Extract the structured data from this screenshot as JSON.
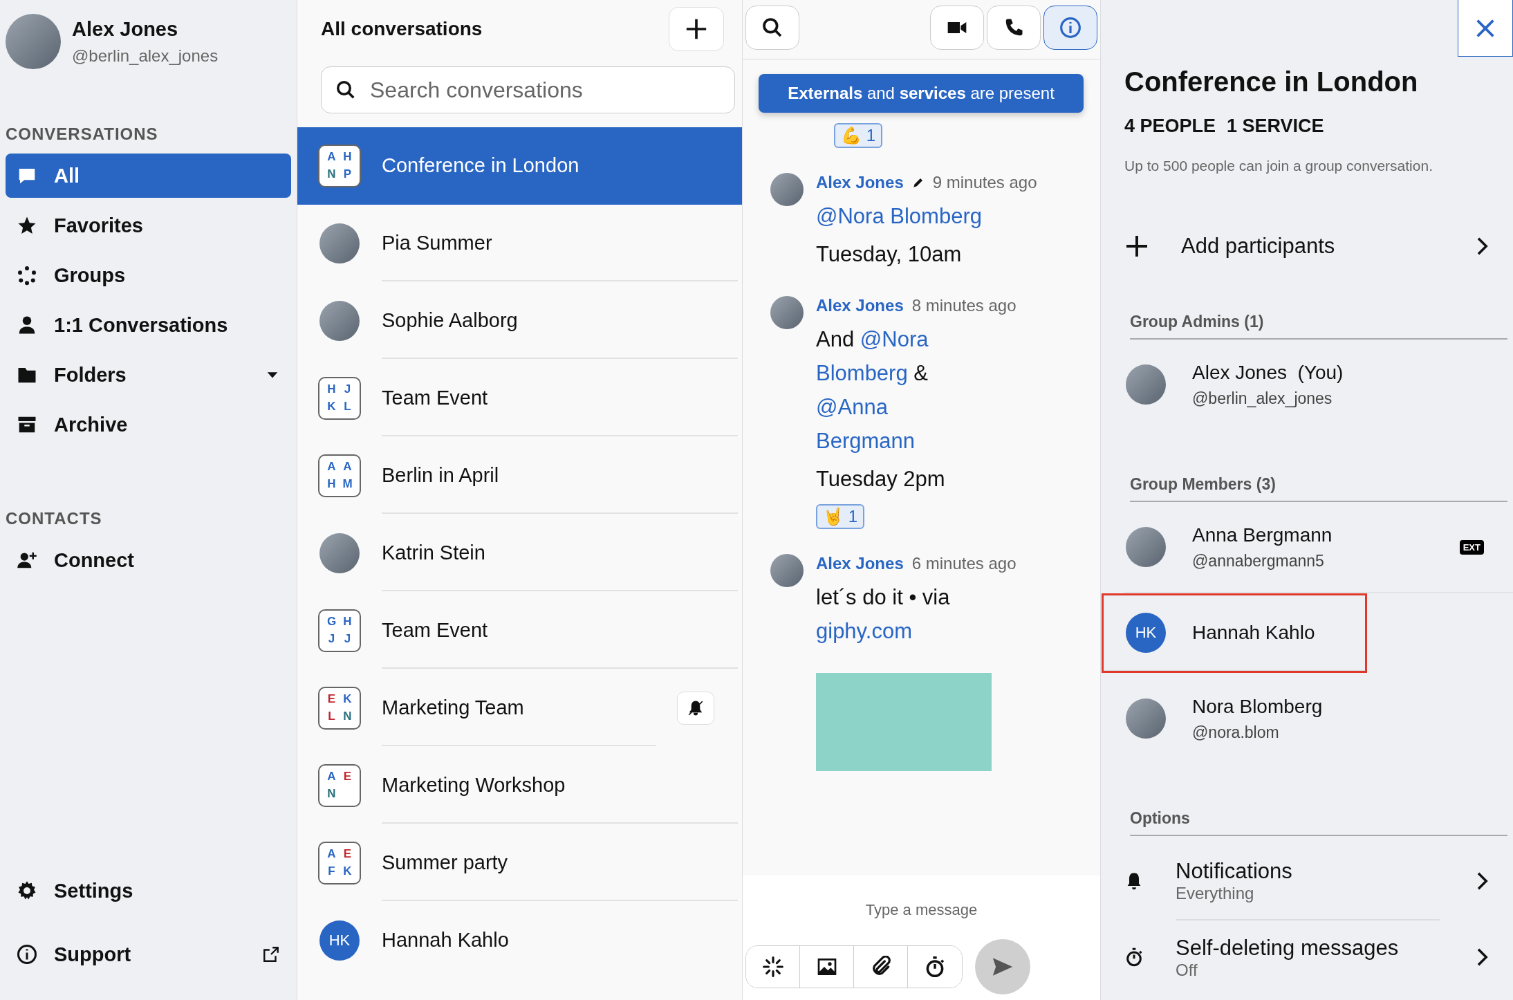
{
  "profile": {
    "name": "Alex Jones",
    "handle": "@berlin_alex_jones"
  },
  "sidebar": {
    "sections": [
      {
        "heading": "CONVERSATIONS",
        "items": [
          {
            "label": "All",
            "kind": "chat",
            "selected": true,
            "dropdown": false
          },
          {
            "label": "Favorites",
            "kind": "star",
            "selected": false,
            "dropdown": false
          },
          {
            "label": "Groups",
            "kind": "groups",
            "selected": false,
            "dropdown": false
          },
          {
            "label": "1:1 Conversations",
            "kind": "person",
            "selected": false,
            "dropdown": false
          },
          {
            "label": "Folders",
            "kind": "folder",
            "selected": false,
            "dropdown": true
          },
          {
            "label": "Archive",
            "kind": "archive",
            "selected": false,
            "dropdown": false
          }
        ]
      },
      {
        "heading": "CONTACTS",
        "items": [
          {
            "label": "Connect",
            "kind": "connect",
            "selected": false,
            "dropdown": false
          }
        ]
      }
    ],
    "footer": [
      {
        "label": "Settings",
        "kind": "gear",
        "external": false
      },
      {
        "label": "Support",
        "kind": "info",
        "external": true
      }
    ]
  },
  "conversation_list": {
    "title": "All conversations",
    "search": {
      "placeholder": "Search conversations"
    },
    "items": [
      {
        "name": "Conference in London",
        "kind": "group",
        "selected": true,
        "muted": false,
        "initials": [
          {
            "letter": "A",
            "color": "#2966c4"
          },
          {
            "letter": "H",
            "color": "#2966c4"
          },
          {
            "letter": "N",
            "color": "#2a6f7f"
          },
          {
            "letter": "P",
            "color": "#2966c4"
          }
        ]
      },
      {
        "name": "Pia Summer",
        "kind": "photo",
        "selected": false,
        "muted": false
      },
      {
        "name": "Sophie Aalborg",
        "kind": "photo",
        "selected": false,
        "muted": false
      },
      {
        "name": "Team Event",
        "kind": "group",
        "selected": false,
        "muted": false,
        "initials": [
          {
            "letter": "H",
            "color": "#2966c4"
          },
          {
            "letter": "J",
            "color": "#2966c4"
          },
          {
            "letter": "K",
            "color": "#2966c4"
          },
          {
            "letter": "L",
            "color": "#2966c4"
          }
        ]
      },
      {
        "name": "Berlin in April",
        "kind": "group",
        "selected": false,
        "muted": false,
        "initials": [
          {
            "letter": "A",
            "color": "#2966c4"
          },
          {
            "letter": "A",
            "color": "#2966c4"
          },
          {
            "letter": "H",
            "color": "#2966c4"
          },
          {
            "letter": "M",
            "color": "#2966c4"
          }
        ]
      },
      {
        "name": "Katrin Stein",
        "kind": "photo",
        "selected": false,
        "muted": false
      },
      {
        "name": "Team Event",
        "kind": "group",
        "selected": false,
        "muted": false,
        "initials": [
          {
            "letter": "G",
            "color": "#2966c4"
          },
          {
            "letter": "H",
            "color": "#2966c4"
          },
          {
            "letter": "J",
            "color": "#2966c4"
          },
          {
            "letter": "J",
            "color": "#2966c4"
          }
        ]
      },
      {
        "name": "Marketing Team",
        "kind": "group",
        "selected": false,
        "muted": true,
        "initials": [
          {
            "letter": "E",
            "color": "#c2262e"
          },
          {
            "letter": "K",
            "color": "#2966c4"
          },
          {
            "letter": "L",
            "color": "#c2262e"
          },
          {
            "letter": "N",
            "color": "#2a6f7f"
          }
        ]
      },
      {
        "name": "Marketing Workshop",
        "kind": "group",
        "selected": false,
        "muted": false,
        "initials": [
          {
            "letter": "A",
            "color": "#2966c4"
          },
          {
            "letter": "E",
            "color": "#c2262e"
          },
          {
            "letter": "N",
            "color": "#2a6f7f"
          }
        ]
      },
      {
        "name": "Summer party",
        "kind": "group",
        "selected": false,
        "muted": false,
        "initials": [
          {
            "letter": "A",
            "color": "#2966c4"
          },
          {
            "letter": "E",
            "color": "#c2262e"
          },
          {
            "letter": "F",
            "color": "#2966c4"
          },
          {
            "letter": "K",
            "color": "#2966c4"
          }
        ]
      },
      {
        "name": "Hannah Kahlo",
        "kind": "initials",
        "selected": false,
        "muted": false,
        "avatar_text": "HK"
      }
    ]
  },
  "chat": {
    "toolbar": {
      "info_open": true
    },
    "banner": "**Externals** and **services** are present",
    "messages": [
      {
        "kind": "partial",
        "reactions": [
          {
            "emoji": "💪",
            "count": "1"
          }
        ]
      },
      {
        "kind": "full",
        "author": "Alex Jones",
        "edited": true,
        "time": "9 minutes ago",
        "lines": [
          [
            {
              "kind": "mention",
              "text": "@Nora Blomberg"
            }
          ],
          [
            {
              "kind": "text",
              "text": "Tuesday, 10am"
            }
          ]
        ]
      },
      {
        "kind": "full",
        "author": "Alex Jones",
        "edited": false,
        "time": "8 minutes ago",
        "lines": [
          [
            {
              "kind": "text",
              "text": "And "
            },
            {
              "kind": "mention",
              "text": "@Nora Blomberg"
            },
            {
              "kind": "text",
              "text": " & "
            },
            {
              "kind": "mention",
              "text": "@Anna Bergmann"
            }
          ],
          [
            {
              "kind": "text",
              "text": "Tuesday 2pm"
            }
          ]
        ],
        "reactions": [
          {
            "emoji": "🤘",
            "count": "1"
          }
        ]
      },
      {
        "kind": "full",
        "author": "Alex Jones",
        "edited": false,
        "time": "6 minutes ago",
        "lines": [
          [
            {
              "kind": "text",
              "text": "let´s do it • via "
            },
            {
              "kind": "link",
              "text": "giphy.com"
            }
          ]
        ],
        "gif": true
      }
    ],
    "composer": {
      "placeholder": "Type a message",
      "tools": [
        {
          "kind": "sparkle"
        },
        {
          "kind": "image"
        },
        {
          "kind": "clip"
        },
        {
          "kind": "timer"
        }
      ],
      "send_enabled": false
    }
  },
  "details": {
    "title": "Conference in London",
    "counts": [
      "4 PEOPLE",
      "1 SERVICE"
    ],
    "note": "Up to 500 people can join a group conversation.",
    "add_label": "Add participants",
    "groups": [
      {
        "heading": "Group Admins (1)",
        "members": [
          {
            "name": "Alex Jones",
            "suffix": "(You)",
            "handle": "@berlin_alex_jones",
            "kind": "photo",
            "external": false,
            "highlighted": false
          }
        ]
      },
      {
        "heading": "Group Members (3)",
        "members": [
          {
            "name": "Anna Bergmann",
            "handle": "@annabergmann5",
            "kind": "photo",
            "external": true,
            "badge": "EXT",
            "highlighted": false
          },
          {
            "name": "Hannah Kahlo",
            "kind": "initials",
            "avatar_text": "HK",
            "external": false,
            "highlighted": true
          },
          {
            "name": "Nora Blomberg",
            "handle": "@nora.blom",
            "kind": "photo",
            "external": false,
            "highlighted": false
          }
        ]
      }
    ],
    "options_heading": "Options",
    "options": [
      {
        "kind": "bell",
        "label": "Notifications",
        "value": "Everything"
      },
      {
        "kind": "timer",
        "label": "Self-deleting messages",
        "value": "Off"
      }
    ]
  }
}
